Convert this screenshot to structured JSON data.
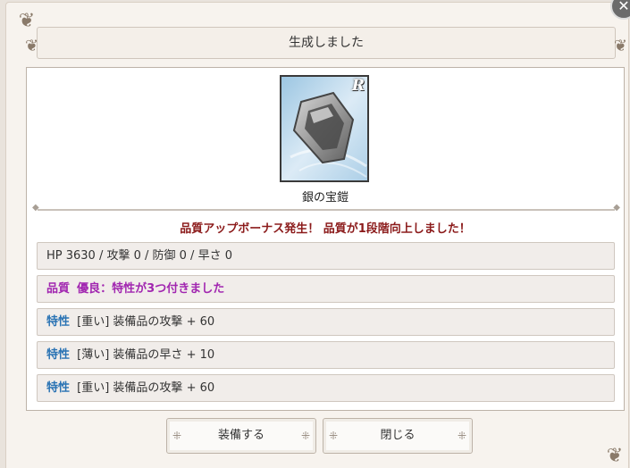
{
  "dialog": {
    "title": "生成しました",
    "close_icon": "close-icon"
  },
  "item": {
    "name": "銀の宝鎧",
    "rarity": "R",
    "icon": "silver-armor-icon"
  },
  "bonus_message": "品質アップボーナス発生！ 品質が1段階向上しました！",
  "stats": "HP 3630 / 攻撃 0 / 防御 0 / 早さ 0",
  "quality": {
    "label": "品質",
    "value": "優良：特性が3つ付きました"
  },
  "traits": [
    {
      "label": "特性",
      "text": "[重い] 装備品の攻撃 + 60"
    },
    {
      "label": "特性",
      "text": "[薄い] 装備品の早さ + 10"
    },
    {
      "label": "特性",
      "text": "[重い] 装備品の攻撃 + 60"
    }
  ],
  "buttons": {
    "equip": "装備する",
    "close": "閉じる"
  },
  "colors": {
    "bonus_text": "#8b1a1a",
    "trait_label": "#2a73b4",
    "quality_text": "#a126b0"
  }
}
